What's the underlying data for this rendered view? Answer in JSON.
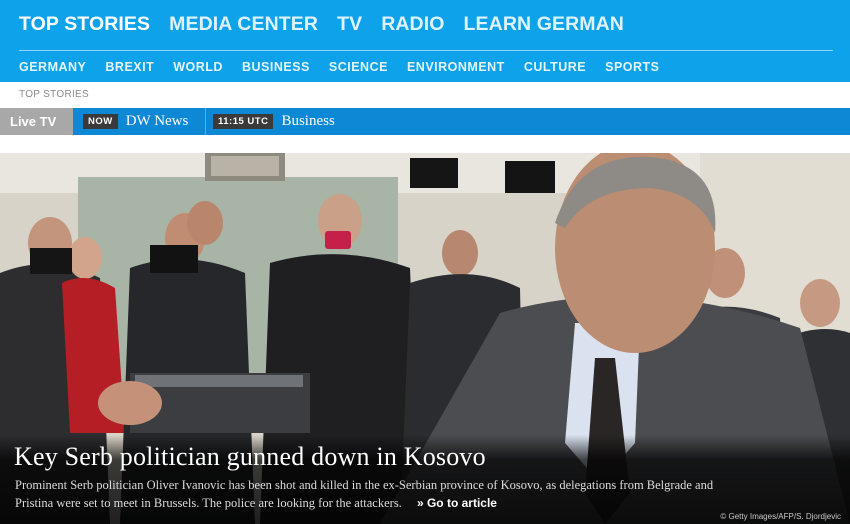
{
  "header": {
    "top_nav": [
      "TOP STORIES",
      "MEDIA CENTER",
      "TV",
      "RADIO",
      "LEARN GERMAN"
    ],
    "sub_nav": [
      "GERMANY",
      "BREXIT",
      "WORLD",
      "BUSINESS",
      "SCIENCE",
      "ENVIRONMENT",
      "CULTURE",
      "SPORTS"
    ],
    "colors": {
      "header_bg": "#0da2ea",
      "live_bar_bg": "#0c88d4"
    }
  },
  "breadcrumb": "TOP STORIES",
  "live_tv": {
    "label": "Live TV",
    "now_tag": "NOW",
    "now_program": "DW News",
    "next_time": "11:15 UTC",
    "next_program": "Business"
  },
  "hero": {
    "headline": "Key Serb politician gunned down in Kosovo",
    "teaser": "Prominent Serb politician Oliver Ivanovic has been shot and killed in the ex-Serbian province of Kosovo, as delegations from Belgrade and Pristina were set to meet in Brussels. The police are looking for the attackers.",
    "link": "» Go to article",
    "credit": "© Getty Images/AFP/S. Djordjevic"
  }
}
